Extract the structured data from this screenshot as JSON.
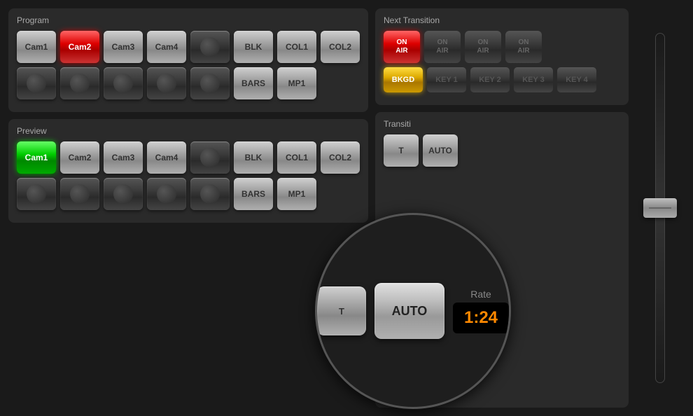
{
  "program": {
    "title": "Program",
    "buttons": [
      {
        "label": "Cam1",
        "state": "normal"
      },
      {
        "label": "Cam2",
        "state": "active-red"
      },
      {
        "label": "Cam3",
        "state": "normal"
      },
      {
        "label": "Cam4",
        "state": "normal"
      },
      {
        "label": "",
        "state": "empty"
      },
      {
        "label": "BLK",
        "state": "normal"
      },
      {
        "label": "COL1",
        "state": "normal"
      },
      {
        "label": "COL2",
        "state": "normal"
      }
    ],
    "buttons2": [
      {
        "label": "",
        "state": "empty"
      },
      {
        "label": "",
        "state": "empty"
      },
      {
        "label": "",
        "state": "empty"
      },
      {
        "label": "",
        "state": "empty"
      },
      {
        "label": "",
        "state": "empty"
      },
      {
        "label": "BARS",
        "state": "normal"
      },
      {
        "label": "MP1",
        "state": "normal"
      }
    ]
  },
  "preview": {
    "title": "Preview",
    "buttons": [
      {
        "label": "Cam1",
        "state": "active-green"
      },
      {
        "label": "Cam2",
        "state": "normal"
      },
      {
        "label": "Cam3",
        "state": "normal"
      },
      {
        "label": "Cam4",
        "state": "normal"
      },
      {
        "label": "",
        "state": "empty"
      },
      {
        "label": "BLK",
        "state": "normal"
      },
      {
        "label": "COL1",
        "state": "normal"
      },
      {
        "label": "COL2",
        "state": "normal"
      }
    ],
    "buttons2": [
      {
        "label": "",
        "state": "empty"
      },
      {
        "label": "",
        "state": "empty"
      },
      {
        "label": "",
        "state": "empty"
      },
      {
        "label": "",
        "state": "empty"
      },
      {
        "label": "",
        "state": "empty"
      },
      {
        "label": "BARS",
        "state": "normal"
      },
      {
        "label": "MP1",
        "state": "normal"
      }
    ]
  },
  "next_transition": {
    "title": "Next Transition",
    "on_air_buttons": [
      {
        "line1": "ON",
        "line2": "AIR",
        "state": "active-red"
      },
      {
        "line1": "ON",
        "line2": "AIR",
        "state": "normal"
      },
      {
        "line1": "ON",
        "line2": "AIR",
        "state": "normal"
      },
      {
        "line1": "ON",
        "line2": "AIR",
        "state": "normal"
      }
    ],
    "key_buttons": [
      {
        "label": "BKGD",
        "state": "active-yellow"
      },
      {
        "label": "KEY 1",
        "state": "normal"
      },
      {
        "label": "KEY 2",
        "state": "normal"
      },
      {
        "label": "KEY 3",
        "state": "normal"
      },
      {
        "label": "KEY 4",
        "state": "normal"
      }
    ]
  },
  "transition": {
    "title": "Transiti",
    "cut_label": "T",
    "auto_label": "AUTO",
    "rate_label": "Rate",
    "rate_value": "1:24"
  }
}
